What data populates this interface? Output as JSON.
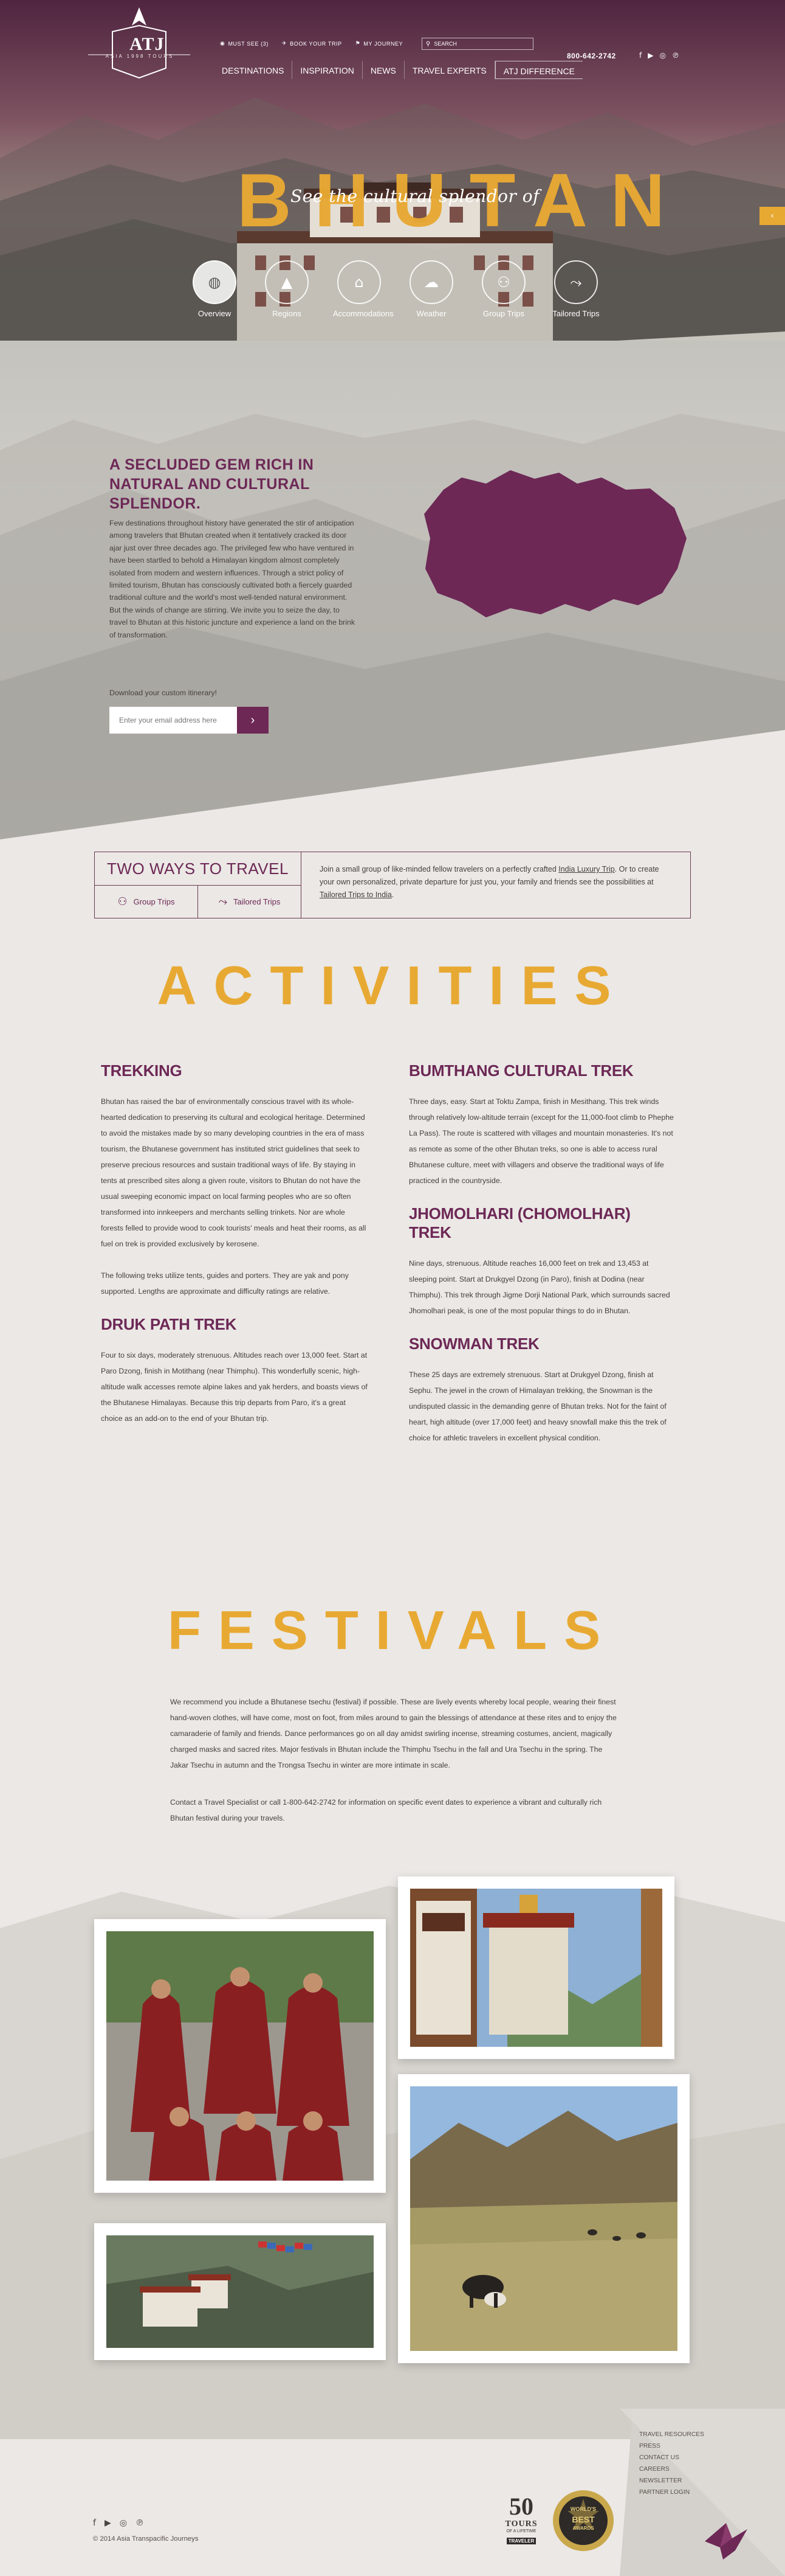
{
  "header": {
    "logo_text": "ATJ",
    "logo_sub": "ASIA   1998   TOURS",
    "utility": [
      {
        "icon": "eye-icon",
        "label": "MUST SEE (3)"
      },
      {
        "icon": "plane-icon",
        "label": "BOOK YOUR TRIP"
      },
      {
        "icon": "route-icon",
        "label": "MY JOURNEY"
      }
    ],
    "search_placeholder": "SEARCH",
    "nav": [
      "DESTINATIONS",
      "INSPIRATION",
      "NEWS",
      "TRAVEL EXPERTS",
      "ATJ DIFFERENCE"
    ],
    "phone": "800-642-2742",
    "social": [
      "f",
      "▶",
      "◎",
      "℗"
    ]
  },
  "hero": {
    "title": "BHUTAN",
    "tagline": "See the cultural splendor of",
    "subnav": [
      {
        "icon": "globe-icon",
        "label": "Overview"
      },
      {
        "icon": "mountain-icon",
        "label": "Regions"
      },
      {
        "icon": "home-icon",
        "label": "Accommodations"
      },
      {
        "icon": "cloud-icon",
        "label": "Weather"
      },
      {
        "icon": "group-icon",
        "label": "Group Trips"
      },
      {
        "icon": "route-icon",
        "label": "Tailored Trips"
      }
    ]
  },
  "intro": {
    "heading": "A SECLUDED GEM RICH IN NATURAL AND CULTURAL SPLENDOR.",
    "body": "Few destinations throughout history have generated the stir of anticipation among travelers that Bhutan created when it tentatively cracked its door ajar just over three decades ago. The privileged few who have ventured in have been startled to behold a Himalayan kingdom almost completely isolated from modern and western influences. Through a strict policy of limited tourism, Bhutan has consciously cultivated both a fiercely guarded traditional culture and the world's most well-tended natural environment. But the winds of change are stirring. We invite you to seize the day, to travel to Bhutan at this historic juncture and experience a land on the brink of transformation.",
    "download_label": "Download your custom itinerary!",
    "email_placeholder": "Enter your email address here",
    "submit_icon": "arrow-right-icon"
  },
  "two_ways": {
    "title": "TWO WAYS TO TRAVEL",
    "options": [
      {
        "icon": "group-icon",
        "label": "Group Trips"
      },
      {
        "icon": "route-icon",
        "label": "Tailored Trips"
      }
    ],
    "text_1": "Join a small group of like-minded fellow travelers on a perfectly crafted ",
    "link_1": "India Luxury Trip",
    "text_2": ". Or to create your own personalized, private departure for just you, your family and friends see the possibilities at ",
    "link_2": "Tailored Trips to India",
    "text_3": "."
  },
  "activities": {
    "title": "ACTIVITIES",
    "left": [
      {
        "heading": "TREKKING",
        "paragraphs": [
          "Bhutan has raised the bar of environmentally conscious travel with its whole-hearted dedication to preserving its cultural and ecological heritage. Determined to avoid the mistakes made by so many developing countries in the era of mass tourism, the Bhutanese government has instituted strict guidelines that seek to preserve precious resources and sustain traditional ways of life. By staying in tents at prescribed sites along a given route, visitors to Bhutan do not have the usual sweeping economic impact on local farming peoples who are so often transformed into innkeepers and merchants selling trinkets. Nor are whole forests felled to provide wood to cook tourists' meals and heat their rooms, as all fuel on trek is provided exclusively by kerosene.",
          "The following treks utilize tents, guides and porters. They are yak and pony supported. Lengths are approximate and difficulty ratings are relative."
        ]
      },
      {
        "heading": "DRUK PATH TREK",
        "paragraphs": [
          "Four to six days, moderately strenuous. Altitudes reach over 13,000 feet. Start at Paro Dzong, finish in Motithang (near Thimphu). This wonderfully scenic, high-altitude walk accesses remote alpine lakes and yak herders, and boasts views of the Bhutanese Himalayas. Because this trip departs from Paro, it's a great choice as an add-on to the end of your Bhutan trip."
        ]
      }
    ],
    "right": [
      {
        "heading": "BUMTHANG CULTURAL TREK",
        "paragraphs": [
          "Three days, easy. Start at Toktu Zampa, finish in Mesithang. This trek winds through relatively low-altitude terrain (except for the 11,000-foot climb to Phephe La Pass). The route is scattered with villages and mountain monasteries. It's not as remote as some of the other Bhutan treks, so one is able to access rural Bhutanese culture, meet with villagers and observe the traditional ways of life practiced in the countryside."
        ]
      },
      {
        "heading": "JHOMOLHARI (CHOMOLHAR) TREK",
        "paragraphs": [
          "Nine days, strenuous. Altitude reaches 16,000 feet on trek and 13,453 at sleeping point. Start at Drukgyel Dzong (in Paro), finish at Dodina (near Thimphu). This trek through Jigme Dorji National Park, which surrounds sacred Jhomolhari peak, is one of the most popular things to do in Bhutan."
        ]
      },
      {
        "heading": "SNOWMAN TREK",
        "paragraphs": [
          "These 25 days are extremely strenuous. Start at Drukgyel Dzong, finish at Sephu. The jewel in the crown of Himalayan trekking, the Snowman is the undisputed classic in the demanding genre of Bhutan treks. Not for the faint of heart, high altitude (over 17,000 feet) and heavy snowfall make this the trek of choice for athletic travelers in excellent physical condition."
        ]
      }
    ]
  },
  "festivals": {
    "title": "FESTIVALS",
    "paragraphs": [
      "We recommend you include a Bhutanese tsechu (festival) if possible. These are lively events whereby local people, wearing their finest hand-woven clothes, will have come, most on foot, from miles around to gain the blessings of attendance at these rites and to enjoy the camaraderie of family and friends. Dance performances go on all day amidst swirling incense, streaming costumes, ancient, magically charged masks and sacred rites. Major festivals in Bhutan include the Thimphu Tsechu in the fall and Ura Tsechu in the spring. The Jakar Tsechu in autumn and the Trongsa Tsechu in winter are more intimate in scale.",
      "Contact a Travel Specialist or call 1-800-642-2742 for information on specific event dates to experience a vibrant and culturally rich Bhutan festival during your travels."
    ]
  },
  "footer": {
    "links": [
      "TRAVEL RESOURCES",
      "PRESS",
      "CONTACT US",
      "CAREERS",
      "NEWSLETTER",
      "PARTNER LOGIN"
    ],
    "social": [
      "f",
      "▶",
      "◎",
      "℗"
    ],
    "copyright": "© 2014 Asia Transpacific Journeys",
    "badge_number": "50",
    "badge_word": "TOURS",
    "badge_small": "OF A LIFETIME",
    "badge_brand": "TRAVELER",
    "badge_wt_top": "WORLD'S",
    "badge_wt_mid": "BEST",
    "badge_wt_bot": "AWARDS"
  },
  "colors": {
    "accent": "#e8a933",
    "brand": "#6d2856",
    "text": "#463f3c",
    "background": "#ebe8e5"
  }
}
